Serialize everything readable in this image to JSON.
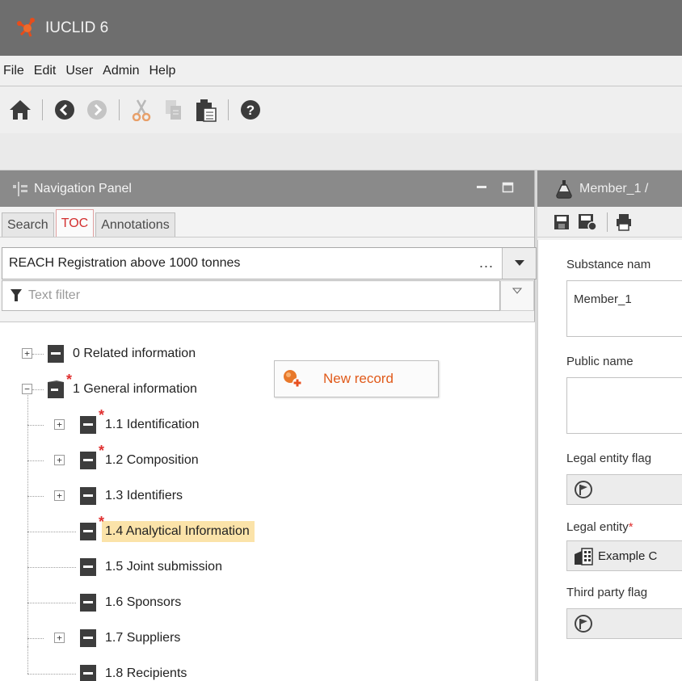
{
  "app": {
    "title": "IUCLID 6"
  },
  "menubar": {
    "items": [
      "File",
      "Edit",
      "User",
      "Admin",
      "Help"
    ]
  },
  "toolbar": {
    "icons": [
      "home-icon",
      "back-icon",
      "forward-icon",
      "cut-icon",
      "copy-icon",
      "paste-icon",
      "help-icon"
    ]
  },
  "navigation_panel": {
    "title": "Navigation Panel",
    "tabs": [
      {
        "label": "Search",
        "active": false
      },
      {
        "label": "TOC",
        "active": true
      },
      {
        "label": "Annotations",
        "active": false
      }
    ],
    "template": {
      "selected": "REACH Registration above 1000 tonnes",
      "more": "..."
    },
    "filter": {
      "placeholder": "Text filter"
    },
    "tree": [
      {
        "label": "0 Related information",
        "expandable": true,
        "required": false,
        "level": 0
      },
      {
        "label": "1 General information",
        "expandable": true,
        "expanded": true,
        "required": true,
        "level": 0
      },
      {
        "label": "1.1 Identification",
        "expandable": true,
        "required": true,
        "level": 1
      },
      {
        "label": "1.2 Composition",
        "expandable": true,
        "required": true,
        "level": 1
      },
      {
        "label": "1.3 Identifiers",
        "expandable": true,
        "required": false,
        "level": 1
      },
      {
        "label": "1.4 Analytical Information",
        "expandable": false,
        "required": true,
        "level": 1,
        "selected": true
      },
      {
        "label": "1.5 Joint submission",
        "expandable": false,
        "required": false,
        "level": 1
      },
      {
        "label": "1.6 Sponsors",
        "expandable": false,
        "required": false,
        "level": 1
      },
      {
        "label": "1.7 Suppliers",
        "expandable": true,
        "required": false,
        "level": 1
      },
      {
        "label": "1.8 Recipients",
        "expandable": false,
        "required": false,
        "level": 1
      }
    ],
    "context_menu": {
      "new_record": "New record"
    }
  },
  "document_panel": {
    "title": "Member_1 /",
    "fields": {
      "substance_name_label": "Substance nam",
      "substance_name_value": "Member_1",
      "public_name_label": "Public name",
      "legal_entity_flag_label": "Legal entity flag",
      "legal_entity_label": "Legal entity",
      "legal_entity_required": "*",
      "legal_entity_value": "Example C",
      "third_party_flag_label": "Third party flag"
    }
  },
  "colors": {
    "title_bar": "#6e6e6e",
    "panel_header": "#8a8a8a",
    "active_tab_text": "#d32f2f",
    "selection": "#fbe3a9",
    "required_star": "#e03030",
    "context_menu_text": "#e05a1a"
  }
}
